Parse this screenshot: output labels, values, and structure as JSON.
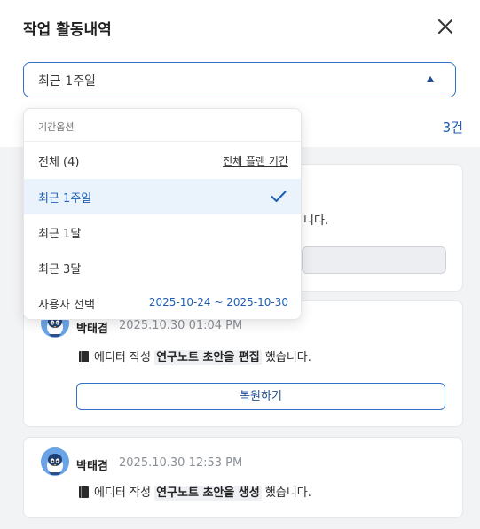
{
  "header": {
    "title": "작업 활동내역",
    "close_icon": "close-icon"
  },
  "period_select": {
    "selected": "최근 1주일"
  },
  "count": {
    "text": "3건"
  },
  "dropdown": {
    "header": "기간옵션",
    "items": [
      {
        "label": "전체 (4)",
        "right": "전체 플랜 기간"
      },
      {
        "label": "최근 1주일",
        "selected": true
      },
      {
        "label": "최근 1달"
      },
      {
        "label": "최근 3달"
      },
      {
        "label": "사용자 선택",
        "right": "2025-10-24 ~ 2025-10-30"
      }
    ]
  },
  "activities": [
    {
      "partial_text": "니다."
    },
    {
      "author": "박태겸",
      "time": "2025.10.30 01:04 PM",
      "prefix": "에디터 작성",
      "highlight": "연구노트 초안을 편집",
      "suffix": "했습니다.",
      "button": "복원하기"
    },
    {
      "author": "박태겸",
      "time": "2025.10.30 12:53 PM",
      "prefix": "에디터 작성",
      "highlight": "연구노트 초안을 생성",
      "suffix": "했습니다."
    }
  ],
  "colors": {
    "accent": "#1e5fb5",
    "selected_bg": "#eaf2fc",
    "border_accent": "#2f6fc4"
  }
}
